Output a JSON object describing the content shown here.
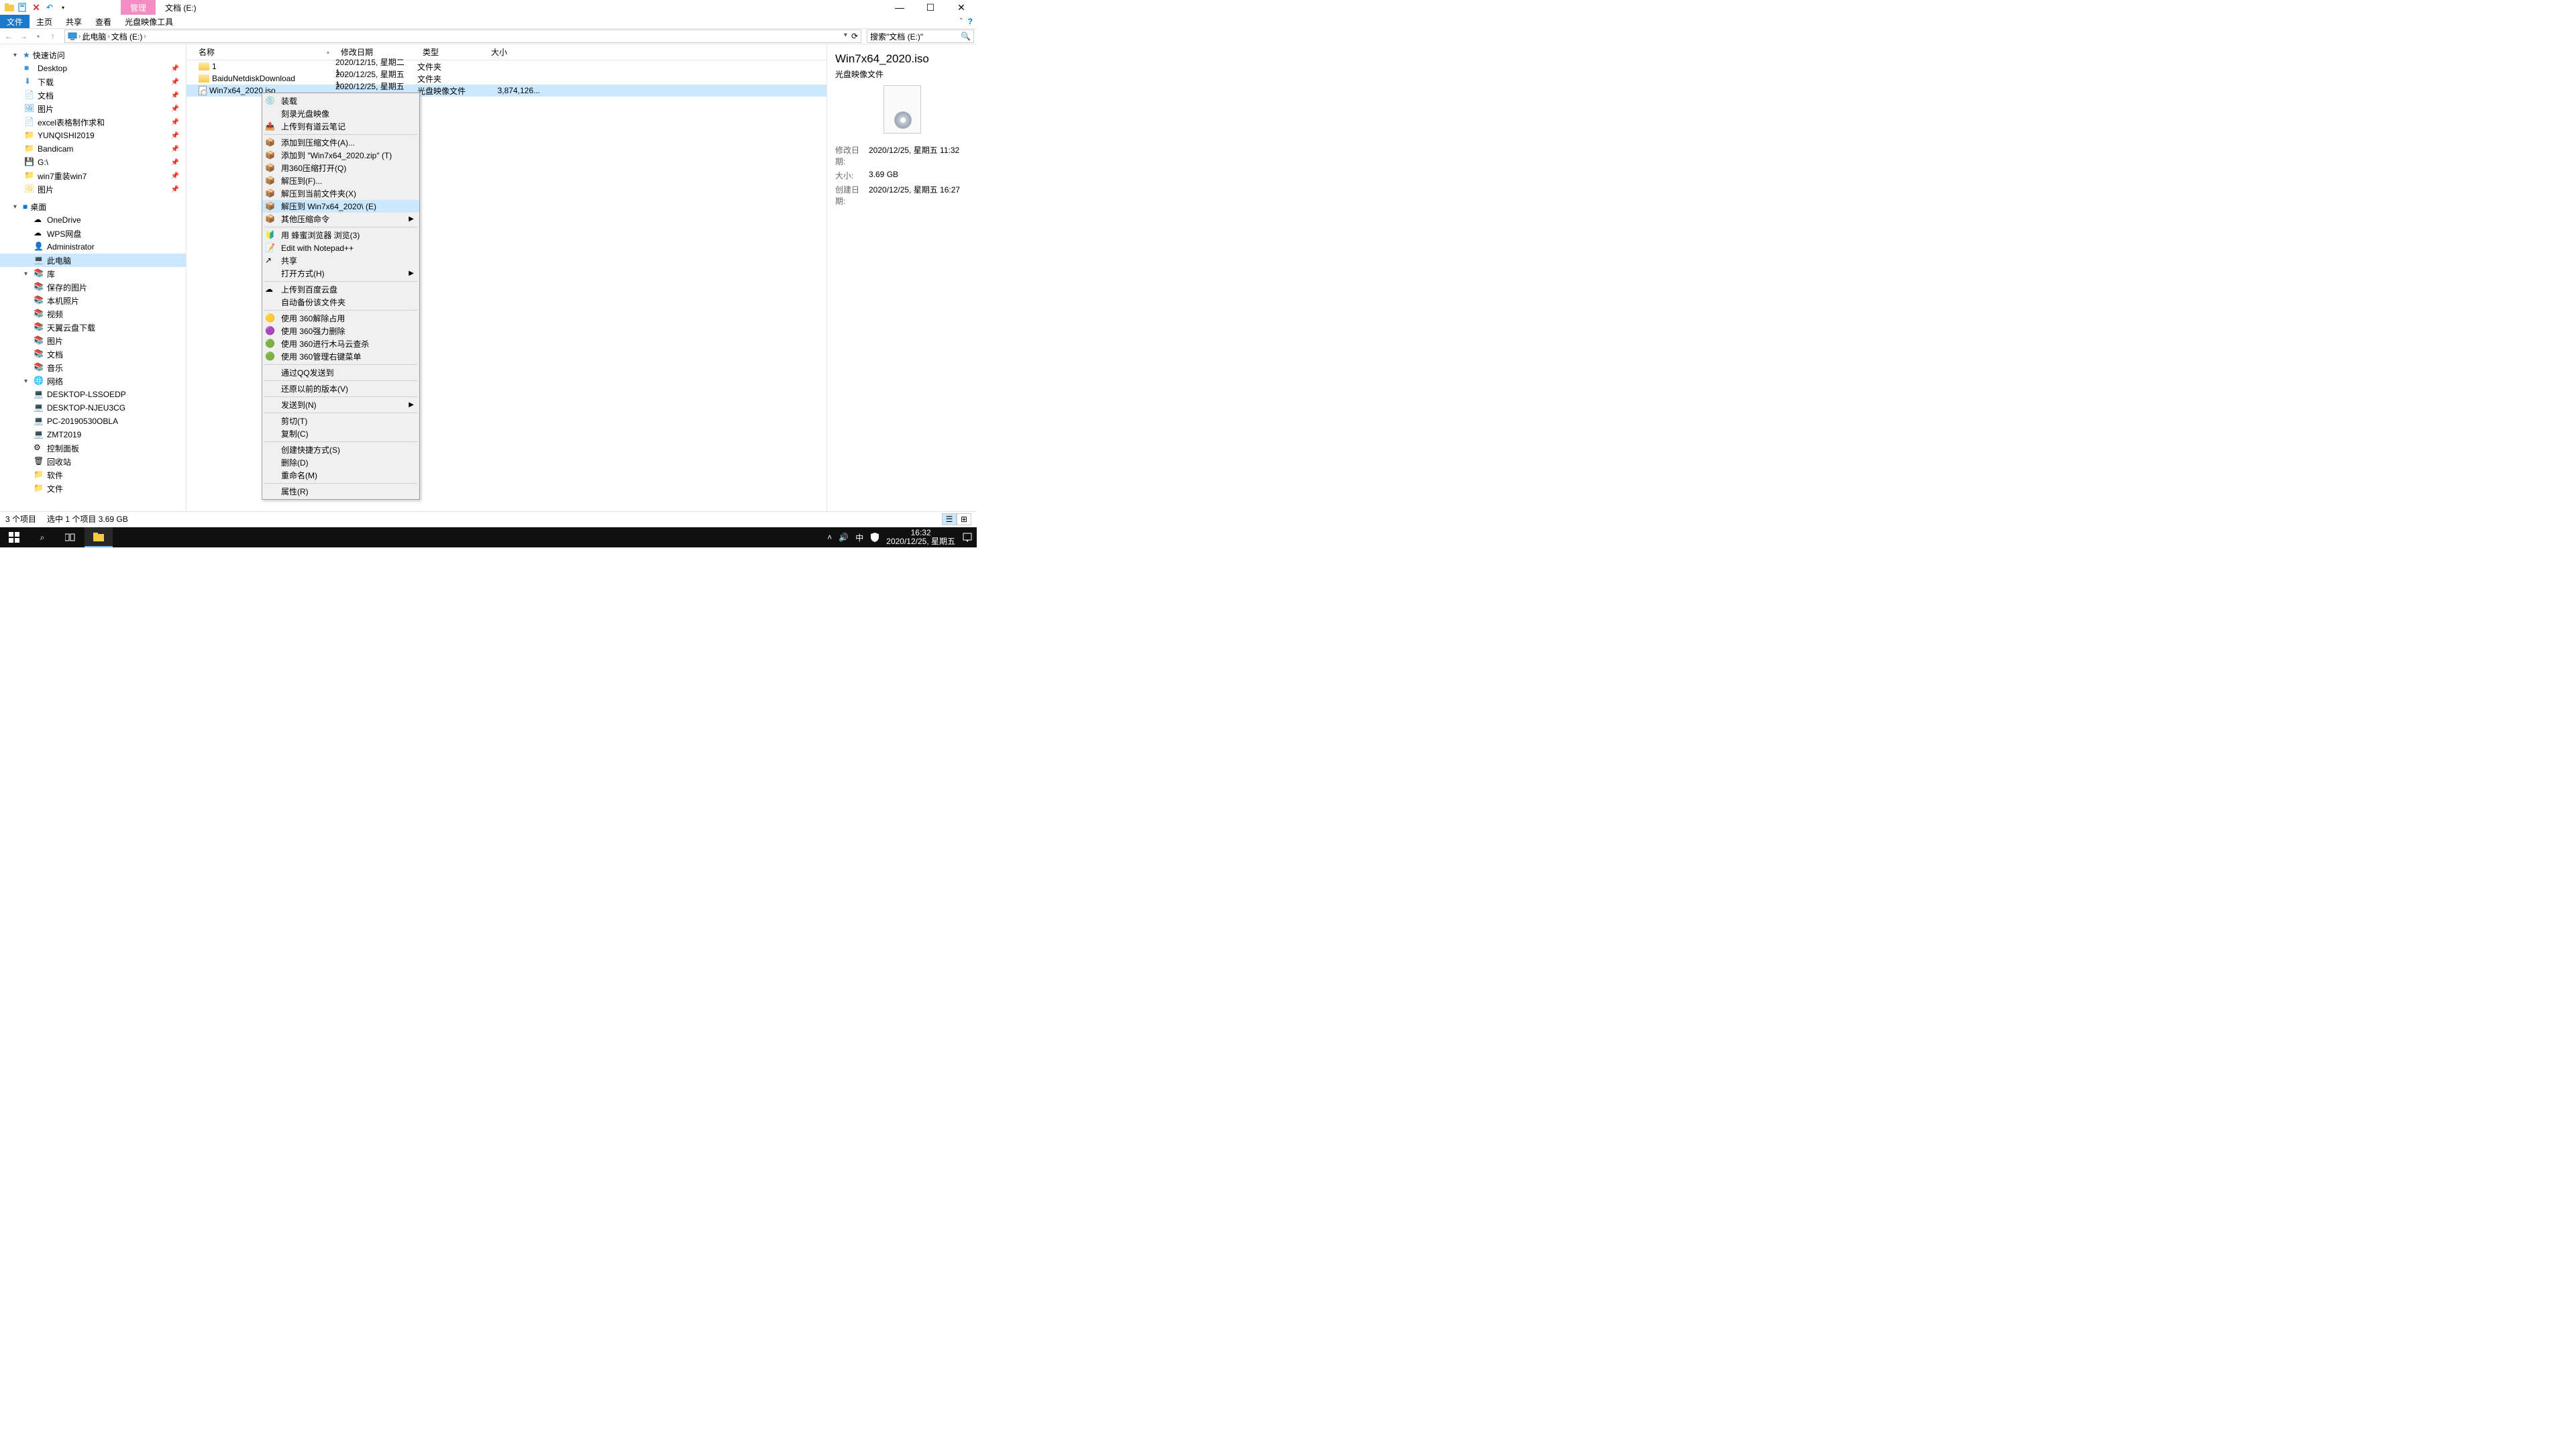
{
  "window": {
    "title": "文档 (E:)",
    "manage_tab": "管理"
  },
  "ribbon": {
    "file": "文件",
    "home": "主页",
    "share": "共享",
    "view": "查看",
    "iso_tools": "光盘映像工具"
  },
  "addr": {
    "thispc": "此电脑",
    "docs": "文档 (E:)"
  },
  "search": {
    "placeholder": "搜索\"文档 (E:)\""
  },
  "nav": {
    "quick": "快速访问",
    "quick_items": [
      "Desktop",
      "下载",
      "文档",
      "图片",
      "excel表格制作求和",
      "YUNQISHI2019",
      "Bandicam",
      "G:\\",
      "win7重装win7",
      "图片"
    ],
    "desktop": "桌面",
    "desktop_items": [
      "OneDrive",
      "WPS网盘",
      "Administrator",
      "此电脑",
      "库",
      "控制面板",
      "回收站",
      "软件",
      "文件"
    ],
    "lib_items": [
      "保存的图片",
      "本机照片",
      "视频",
      "天翼云盘下载",
      "图片",
      "文档",
      "音乐"
    ],
    "network": "网络",
    "net_items": [
      "DESKTOP-LSSOEDP",
      "DESKTOP-NJEU3CG",
      "PC-20190530OBLA",
      "ZMT2019"
    ]
  },
  "cols": {
    "name": "名称",
    "mod": "修改日期",
    "type": "类型",
    "size": "大小"
  },
  "files": [
    {
      "name": "1",
      "mod": "2020/12/15, 星期二 1...",
      "type": "文件夹",
      "size": "",
      "icon": "folder"
    },
    {
      "name": "BaiduNetdiskDownload",
      "mod": "2020/12/25, 星期五 1...",
      "type": "文件夹",
      "size": "",
      "icon": "folder"
    },
    {
      "name": "Win7x64_2020.iso",
      "mod": "2020/12/25, 星期五 1...",
      "type": "光盘映像文件",
      "size": "3,874,126...",
      "icon": "disc",
      "sel": true
    }
  ],
  "preview": {
    "title": "Win7x64_2020.iso",
    "type": "光盘映像文件",
    "rows": [
      {
        "label": "修改日期:",
        "val": "2020/12/25, 星期五 11:32"
      },
      {
        "label": "大小:",
        "val": "3.69 GB"
      },
      {
        "label": "创建日期:",
        "val": "2020/12/25, 星期五 16:27"
      }
    ]
  },
  "status": {
    "count": "3 个项目",
    "sel": "选中 1 个项目  3.69 GB"
  },
  "ctx": [
    {
      "t": "装载",
      "icon": "disc"
    },
    {
      "t": "刻录光盘映像"
    },
    {
      "t": "上传到有道云笔记",
      "icon": "blue"
    },
    {
      "sep": true
    },
    {
      "t": "添加到压缩文件(A)...",
      "icon": "zip"
    },
    {
      "t": "添加到 \"Win7x64_2020.zip\" (T)",
      "icon": "zip"
    },
    {
      "t": "用360压缩打开(Q)",
      "icon": "zip"
    },
    {
      "t": "解压到(F)...",
      "icon": "zip"
    },
    {
      "t": "解压到当前文件夹(X)",
      "icon": "zip"
    },
    {
      "t": "解压到 Win7x64_2020\\ (E)",
      "icon": "zip",
      "hov": true
    },
    {
      "t": "其他压缩命令",
      "icon": "zip",
      "arrow": true
    },
    {
      "sep": true
    },
    {
      "t": "用 蜂蜜浏览器 浏览(3)",
      "icon": "green"
    },
    {
      "t": "Edit with Notepad++",
      "icon": "npp"
    },
    {
      "t": "共享",
      "icon": "share"
    },
    {
      "t": "打开方式(H)",
      "arrow": true
    },
    {
      "sep": true
    },
    {
      "t": "上传到百度云盘",
      "icon": "baidu"
    },
    {
      "t": "自动备份该文件夹",
      "disabled": true
    },
    {
      "sep": true
    },
    {
      "t": "使用 360解除占用",
      "icon": "y360"
    },
    {
      "t": "使用 360强力删除",
      "icon": "p360"
    },
    {
      "t": "使用 360进行木马云查杀",
      "icon": "g360"
    },
    {
      "t": "使用 360管理右键菜单",
      "icon": "g360"
    },
    {
      "sep": true
    },
    {
      "t": "通过QQ发送到"
    },
    {
      "sep": true
    },
    {
      "t": "还原以前的版本(V)"
    },
    {
      "sep": true
    },
    {
      "t": "发送到(N)",
      "arrow": true
    },
    {
      "sep": true
    },
    {
      "t": "剪切(T)"
    },
    {
      "t": "复制(C)"
    },
    {
      "sep": true
    },
    {
      "t": "创建快捷方式(S)"
    },
    {
      "t": "删除(D)"
    },
    {
      "t": "重命名(M)"
    },
    {
      "sep": true
    },
    {
      "t": "属性(R)"
    }
  ],
  "taskbar": {
    "time": "16:32",
    "date": "2020/12/25, 星期五",
    "ime": "中"
  }
}
